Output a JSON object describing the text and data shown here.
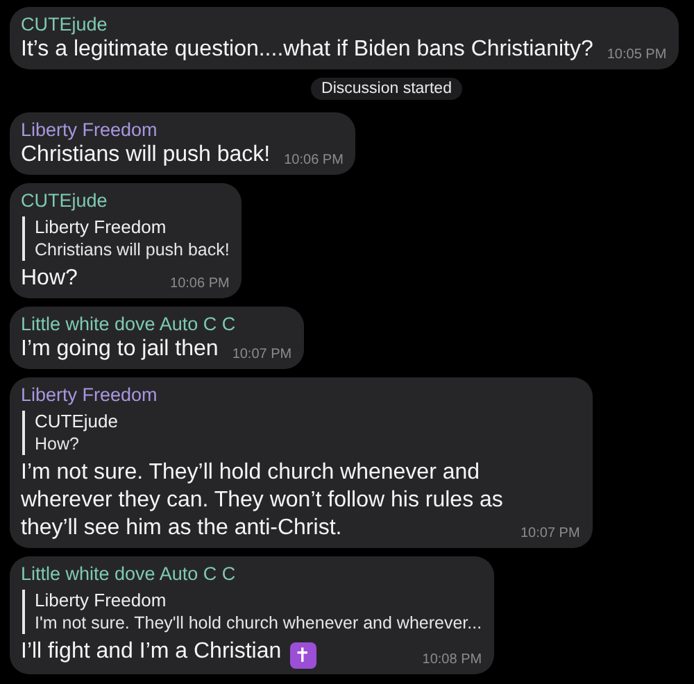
{
  "messages": [
    {
      "kind": "message",
      "sender": "CUTEjude",
      "color": "#7fcab0",
      "text": "It’s a legitimate question....what if Biden bans Christianity?",
      "time": "10:05 PM"
    },
    {
      "kind": "notice",
      "text": "Discussion started"
    },
    {
      "kind": "message",
      "sender": "Liberty Freedom",
      "color": "#a897e0",
      "text": "Christians will push back!",
      "time": "10:06 PM"
    },
    {
      "kind": "message",
      "sender": "CUTEjude",
      "color": "#7fcab0",
      "reply": {
        "sender": "Liberty Freedom",
        "text": "Christians will push back!"
      },
      "text": "How?",
      "time": "10:06 PM"
    },
    {
      "kind": "message",
      "sender": "Little white dove Auto C C",
      "color": "#7fcab0",
      "text": "I’m going to jail then",
      "time": "10:07 PM"
    },
    {
      "kind": "message",
      "sender": "Liberty Freedom",
      "color": "#a897e0",
      "reply": {
        "sender": "CUTEjude",
        "text": "How?"
      },
      "text": "I’m not sure. They’ll hold church whenever and wherever they can. They won’t follow his rules as they’ll see him as the anti-Christ.",
      "time": "10:07 PM"
    },
    {
      "kind": "message",
      "sender": "Little white dove Auto C C",
      "color": "#7fcab0",
      "reply": {
        "sender": "Liberty Freedom",
        "text": "I'm not sure. They'll hold church whenever and wherever..."
      },
      "text": "I’ll fight and I’m a Christian",
      "emoji": "✝",
      "time": "10:08 PM"
    }
  ]
}
